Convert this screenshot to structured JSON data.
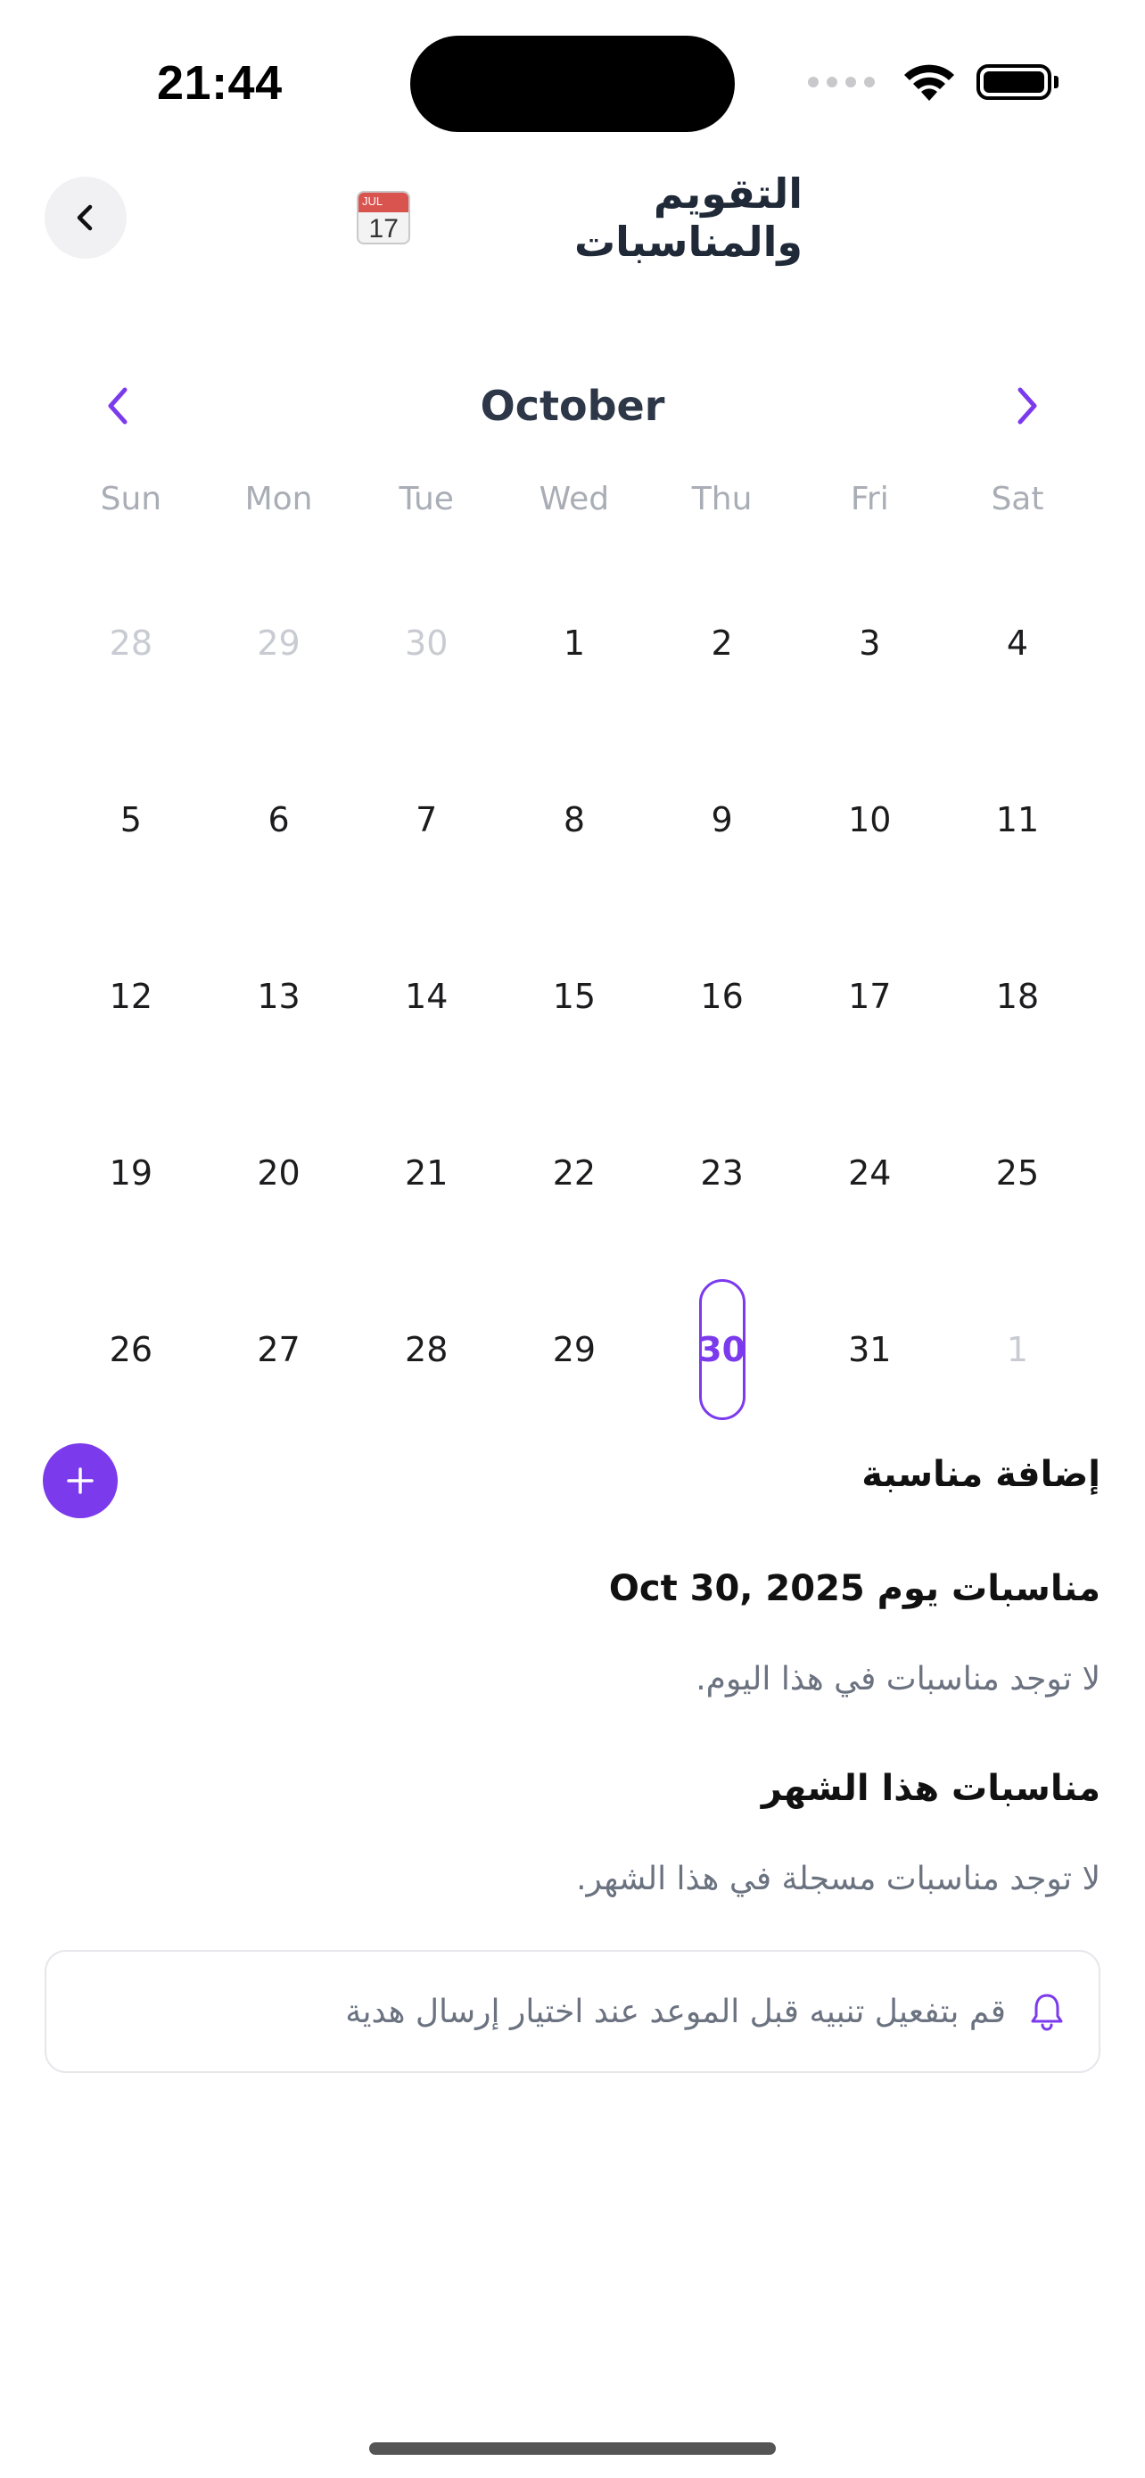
{
  "status": {
    "time": "21:44"
  },
  "header": {
    "title": "التقويم والمناسبات",
    "emoji_month": "JUL",
    "emoji_day": "17"
  },
  "calendar": {
    "month": "October",
    "weekdays": [
      "Sun",
      "Mon",
      "Tue",
      "Wed",
      "Thu",
      "Fri",
      "Sat"
    ],
    "weeks": [
      [
        {
          "d": "28",
          "out": true
        },
        {
          "d": "29",
          "out": true
        },
        {
          "d": "30",
          "out": true
        },
        {
          "d": "1"
        },
        {
          "d": "2"
        },
        {
          "d": "3"
        },
        {
          "d": "4"
        }
      ],
      [
        {
          "d": "5"
        },
        {
          "d": "6"
        },
        {
          "d": "7"
        },
        {
          "d": "8"
        },
        {
          "d": "9"
        },
        {
          "d": "10"
        },
        {
          "d": "11"
        }
      ],
      [
        {
          "d": "12"
        },
        {
          "d": "13"
        },
        {
          "d": "14"
        },
        {
          "d": "15"
        },
        {
          "d": "16"
        },
        {
          "d": "17"
        },
        {
          "d": "18"
        }
      ],
      [
        {
          "d": "19"
        },
        {
          "d": "20"
        },
        {
          "d": "21"
        },
        {
          "d": "22"
        },
        {
          "d": "23"
        },
        {
          "d": "24"
        },
        {
          "d": "25"
        }
      ],
      [
        {
          "d": "26"
        },
        {
          "d": "27"
        },
        {
          "d": "28"
        },
        {
          "d": "29"
        },
        {
          "d": "30",
          "selected": true
        },
        {
          "d": "31"
        },
        {
          "d": "1",
          "out": true
        }
      ]
    ],
    "accent": "#7c3aed"
  },
  "add_event": {
    "label": "إضافة مناسبة"
  },
  "day_events": {
    "title": "مناسبات يوم Oct 30, 2025",
    "empty": "لا توجد مناسبات في هذا اليوم."
  },
  "month_events": {
    "title": "مناسبات هذا الشهر",
    "empty": "لا توجد مناسبات مسجلة في هذا الشهر."
  },
  "reminder": {
    "text": "قم بتفعيل تنبيه قبل الموعد عند اختيار إرسال هدية"
  }
}
